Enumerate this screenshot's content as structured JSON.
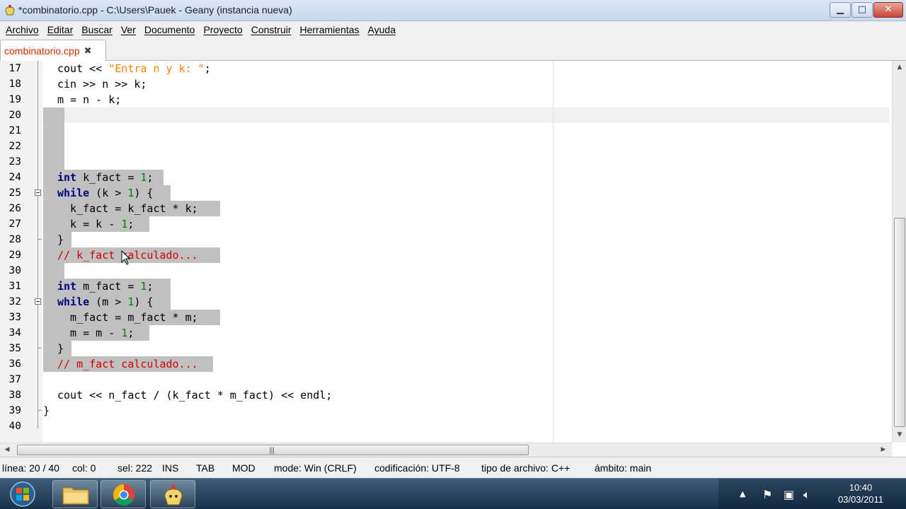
{
  "window": {
    "title": "*combinatorio.cpp - C:\\Users\\Pauek - Geany (instancia nueva)",
    "minimize_glyph": "▁",
    "maximize_glyph": "□",
    "close_glyph": "✕"
  },
  "menu": {
    "items": [
      "Archivo",
      "Editar",
      "Buscar",
      "Ver",
      "Documento",
      "Proyecto",
      "Construir",
      "Herramientas",
      "Ayuda"
    ]
  },
  "tabs": [
    {
      "label": "combinatorio.cpp",
      "modified": true,
      "close_glyph": "✖"
    }
  ],
  "editor": {
    "line_numbers": [
      "17",
      "18",
      "19",
      "20",
      "21",
      "22",
      "23",
      "24",
      "25",
      "26",
      "27",
      "28",
      "29",
      "30",
      "31",
      "32",
      "33",
      "34",
      "35",
      "36",
      "37",
      "38",
      "39",
      "40"
    ],
    "lines": [
      "cout << \"Entra n y k: \";",
      "cin >> n >> k;",
      "m = n - k;",
      "",
      "",
      "",
      "",
      "int k_fact = 1;",
      "while (k > 1) {",
      "  k_fact = k_fact * k;",
      "  k = k - 1;",
      "}",
      "// k_fact calculado...",
      "",
      "int m_fact = 1;",
      "while (m > 1) {",
      "  m_fact = m_fact * m;",
      "  m = m - 1;",
      "}",
      "// m_fact calculado...",
      "",
      "cout << n_fact / (k_fact * m_fact) << endl;",
      "}",
      ""
    ]
  },
  "statusbar": {
    "line": "línea: 20 / 40",
    "col": "col: 0",
    "sel": "sel: 222",
    "ins": "INS",
    "tab": "TAB",
    "mod": "MOD",
    "mode": "mode: Win (CRLF)",
    "encoding": "codificación: UTF-8",
    "filetype": "tipo de archivo: C++",
    "scope": "ámbito: main"
  },
  "taskbar": {
    "apps": [
      "start-button",
      "explorer",
      "chrome",
      "geany"
    ],
    "clock_time": "10:40",
    "clock_date": "03/03/2011",
    "tray_icons": [
      "show-hidden-icons",
      "action-center-flag",
      "network",
      "volume"
    ]
  },
  "colors": {
    "keyword": "#00007f",
    "string": "#ff8000",
    "number": "#007f00",
    "comment": "#d00000",
    "selection": "#c0c0c0",
    "tab_modified": "#d42b00"
  }
}
